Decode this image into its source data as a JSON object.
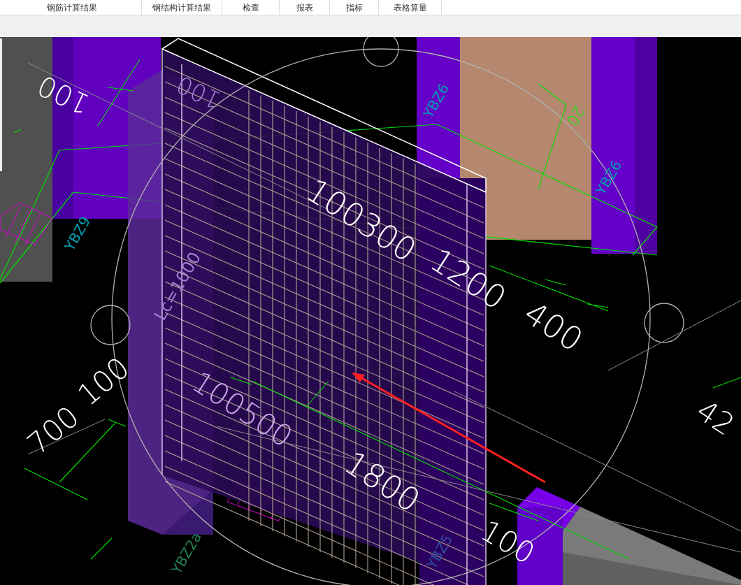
{
  "menu": {
    "tabs": [
      {
        "label": "钢筋计算结果"
      },
      {
        "label": "钢结构计算结果"
      },
      {
        "label": "检查"
      },
      {
        "label": "报表"
      },
      {
        "label": "指标"
      },
      {
        "label": "表格算量"
      }
    ]
  },
  "viewport": {
    "labels": [
      {
        "text": "100",
        "kind": "dimension",
        "color": "#ffffff"
      },
      {
        "text": "100",
        "kind": "dimension",
        "color": "#a080d0"
      },
      {
        "text": "YBZ9",
        "kind": "tag",
        "color": "#00a0b0"
      },
      {
        "text": "YBZ6",
        "kind": "tag",
        "color": "#00a0b0"
      },
      {
        "text": "YBZ6",
        "kind": "tag",
        "color": "#00a0b0"
      },
      {
        "text": "20",
        "kind": "dimension",
        "color": "#00ff00"
      },
      {
        "text": "100300",
        "kind": "dimension",
        "color": "#ffffff"
      },
      {
        "text": "1200",
        "kind": "dimension",
        "color": "#ffffff"
      },
      {
        "text": "400",
        "kind": "dimension",
        "color": "#ffffff"
      },
      {
        "text": "Lc=1000",
        "kind": "tag",
        "color": "#a080d0"
      },
      {
        "text": "100",
        "kind": "dimension",
        "color": "#ffffff"
      },
      {
        "text": "700",
        "kind": "dimension",
        "color": "#ffffff"
      },
      {
        "text": "100500",
        "kind": "dimension",
        "color": "#c8a8e8"
      },
      {
        "text": "1800",
        "kind": "dimension",
        "color": "#ffffff"
      },
      {
        "text": "YBZ2a",
        "kind": "tag",
        "color": "#208050"
      },
      {
        "text": "YBZ5",
        "kind": "tag",
        "color": "#3050a0"
      },
      {
        "text": "100",
        "kind": "dimension",
        "color": "#ffffff"
      },
      {
        "text": "42",
        "kind": "dimension",
        "color": "#ffffff"
      }
    ]
  }
}
